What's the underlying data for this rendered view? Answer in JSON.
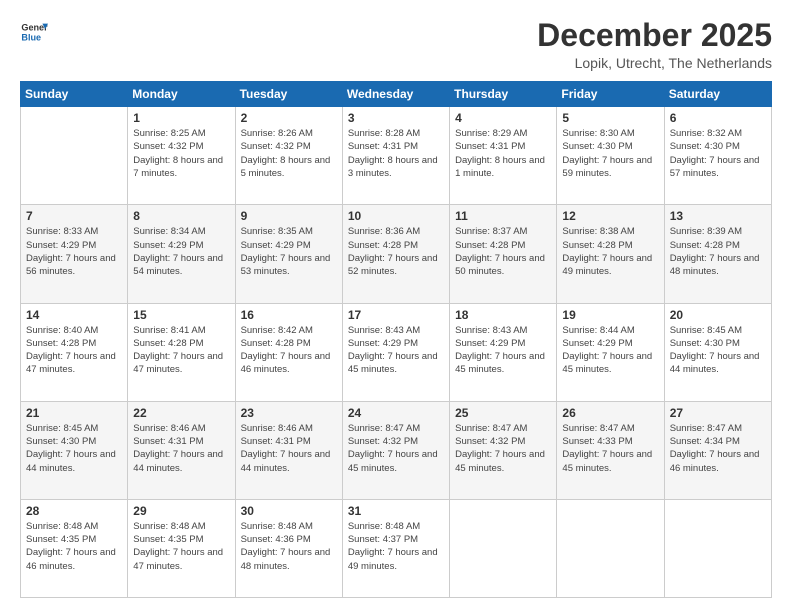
{
  "logo": {
    "line1": "General",
    "line2": "Blue"
  },
  "title": "December 2025",
  "location": "Lopik, Utrecht, The Netherlands",
  "days_header": [
    "Sunday",
    "Monday",
    "Tuesday",
    "Wednesday",
    "Thursday",
    "Friday",
    "Saturday"
  ],
  "weeks": [
    [
      {
        "day": "",
        "sunrise": "",
        "sunset": "",
        "daylight": ""
      },
      {
        "day": "1",
        "sunrise": "Sunrise: 8:25 AM",
        "sunset": "Sunset: 4:32 PM",
        "daylight": "Daylight: 8 hours and 7 minutes."
      },
      {
        "day": "2",
        "sunrise": "Sunrise: 8:26 AM",
        "sunset": "Sunset: 4:32 PM",
        "daylight": "Daylight: 8 hours and 5 minutes."
      },
      {
        "day": "3",
        "sunrise": "Sunrise: 8:28 AM",
        "sunset": "Sunset: 4:31 PM",
        "daylight": "Daylight: 8 hours and 3 minutes."
      },
      {
        "day": "4",
        "sunrise": "Sunrise: 8:29 AM",
        "sunset": "Sunset: 4:31 PM",
        "daylight": "Daylight: 8 hours and 1 minute."
      },
      {
        "day": "5",
        "sunrise": "Sunrise: 8:30 AM",
        "sunset": "Sunset: 4:30 PM",
        "daylight": "Daylight: 7 hours and 59 minutes."
      },
      {
        "day": "6",
        "sunrise": "Sunrise: 8:32 AM",
        "sunset": "Sunset: 4:30 PM",
        "daylight": "Daylight: 7 hours and 57 minutes."
      }
    ],
    [
      {
        "day": "7",
        "sunrise": "Sunrise: 8:33 AM",
        "sunset": "Sunset: 4:29 PM",
        "daylight": "Daylight: 7 hours and 56 minutes."
      },
      {
        "day": "8",
        "sunrise": "Sunrise: 8:34 AM",
        "sunset": "Sunset: 4:29 PM",
        "daylight": "Daylight: 7 hours and 54 minutes."
      },
      {
        "day": "9",
        "sunrise": "Sunrise: 8:35 AM",
        "sunset": "Sunset: 4:29 PM",
        "daylight": "Daylight: 7 hours and 53 minutes."
      },
      {
        "day": "10",
        "sunrise": "Sunrise: 8:36 AM",
        "sunset": "Sunset: 4:28 PM",
        "daylight": "Daylight: 7 hours and 52 minutes."
      },
      {
        "day": "11",
        "sunrise": "Sunrise: 8:37 AM",
        "sunset": "Sunset: 4:28 PM",
        "daylight": "Daylight: 7 hours and 50 minutes."
      },
      {
        "day": "12",
        "sunrise": "Sunrise: 8:38 AM",
        "sunset": "Sunset: 4:28 PM",
        "daylight": "Daylight: 7 hours and 49 minutes."
      },
      {
        "day": "13",
        "sunrise": "Sunrise: 8:39 AM",
        "sunset": "Sunset: 4:28 PM",
        "daylight": "Daylight: 7 hours and 48 minutes."
      }
    ],
    [
      {
        "day": "14",
        "sunrise": "Sunrise: 8:40 AM",
        "sunset": "Sunset: 4:28 PM",
        "daylight": "Daylight: 7 hours and 47 minutes."
      },
      {
        "day": "15",
        "sunrise": "Sunrise: 8:41 AM",
        "sunset": "Sunset: 4:28 PM",
        "daylight": "Daylight: 7 hours and 47 minutes."
      },
      {
        "day": "16",
        "sunrise": "Sunrise: 8:42 AM",
        "sunset": "Sunset: 4:28 PM",
        "daylight": "Daylight: 7 hours and 46 minutes."
      },
      {
        "day": "17",
        "sunrise": "Sunrise: 8:43 AM",
        "sunset": "Sunset: 4:29 PM",
        "daylight": "Daylight: 7 hours and 45 minutes."
      },
      {
        "day": "18",
        "sunrise": "Sunrise: 8:43 AM",
        "sunset": "Sunset: 4:29 PM",
        "daylight": "Daylight: 7 hours and 45 minutes."
      },
      {
        "day": "19",
        "sunrise": "Sunrise: 8:44 AM",
        "sunset": "Sunset: 4:29 PM",
        "daylight": "Daylight: 7 hours and 45 minutes."
      },
      {
        "day": "20",
        "sunrise": "Sunrise: 8:45 AM",
        "sunset": "Sunset: 4:30 PM",
        "daylight": "Daylight: 7 hours and 44 minutes."
      }
    ],
    [
      {
        "day": "21",
        "sunrise": "Sunrise: 8:45 AM",
        "sunset": "Sunset: 4:30 PM",
        "daylight": "Daylight: 7 hours and 44 minutes."
      },
      {
        "day": "22",
        "sunrise": "Sunrise: 8:46 AM",
        "sunset": "Sunset: 4:31 PM",
        "daylight": "Daylight: 7 hours and 44 minutes."
      },
      {
        "day": "23",
        "sunrise": "Sunrise: 8:46 AM",
        "sunset": "Sunset: 4:31 PM",
        "daylight": "Daylight: 7 hours and 44 minutes."
      },
      {
        "day": "24",
        "sunrise": "Sunrise: 8:47 AM",
        "sunset": "Sunset: 4:32 PM",
        "daylight": "Daylight: 7 hours and 45 minutes."
      },
      {
        "day": "25",
        "sunrise": "Sunrise: 8:47 AM",
        "sunset": "Sunset: 4:32 PM",
        "daylight": "Daylight: 7 hours and 45 minutes."
      },
      {
        "day": "26",
        "sunrise": "Sunrise: 8:47 AM",
        "sunset": "Sunset: 4:33 PM",
        "daylight": "Daylight: 7 hours and 45 minutes."
      },
      {
        "day": "27",
        "sunrise": "Sunrise: 8:47 AM",
        "sunset": "Sunset: 4:34 PM",
        "daylight": "Daylight: 7 hours and 46 minutes."
      }
    ],
    [
      {
        "day": "28",
        "sunrise": "Sunrise: 8:48 AM",
        "sunset": "Sunset: 4:35 PM",
        "daylight": "Daylight: 7 hours and 46 minutes."
      },
      {
        "day": "29",
        "sunrise": "Sunrise: 8:48 AM",
        "sunset": "Sunset: 4:35 PM",
        "daylight": "Daylight: 7 hours and 47 minutes."
      },
      {
        "day": "30",
        "sunrise": "Sunrise: 8:48 AM",
        "sunset": "Sunset: 4:36 PM",
        "daylight": "Daylight: 7 hours and 48 minutes."
      },
      {
        "day": "31",
        "sunrise": "Sunrise: 8:48 AM",
        "sunset": "Sunset: 4:37 PM",
        "daylight": "Daylight: 7 hours and 49 minutes."
      },
      {
        "day": "",
        "sunrise": "",
        "sunset": "",
        "daylight": ""
      },
      {
        "day": "",
        "sunrise": "",
        "sunset": "",
        "daylight": ""
      },
      {
        "day": "",
        "sunrise": "",
        "sunset": "",
        "daylight": ""
      }
    ]
  ]
}
